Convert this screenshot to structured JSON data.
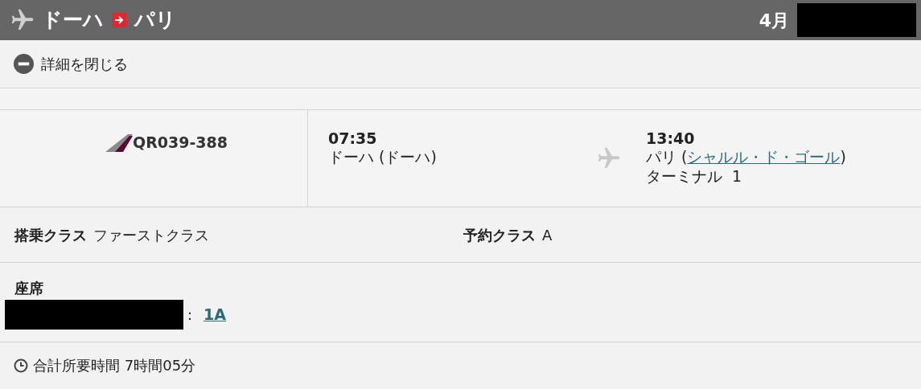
{
  "header": {
    "origin": "ドーハ",
    "destination": "パリ",
    "month": "4月"
  },
  "toggle": {
    "label": "詳細を閉じる",
    "expanded": true
  },
  "flight": {
    "number": "QR039-388",
    "departure": {
      "time": "07:35",
      "place": "ドーハ (ドーハ)"
    },
    "arrival": {
      "time": "13:40",
      "city": "パリ (",
      "airport": "シャルル・ド・ゴール",
      "close": ")",
      "terminal": "ターミナル  1"
    }
  },
  "cabin": {
    "label": "搭乗クラス",
    "value": "ファーストクラス"
  },
  "booking_class": {
    "label": "予約クラス",
    "value": "A"
  },
  "seat": {
    "label": "座席",
    "separator": ":",
    "value": "1A"
  },
  "duration": {
    "label": "合計所要時間 7時間05分"
  }
}
